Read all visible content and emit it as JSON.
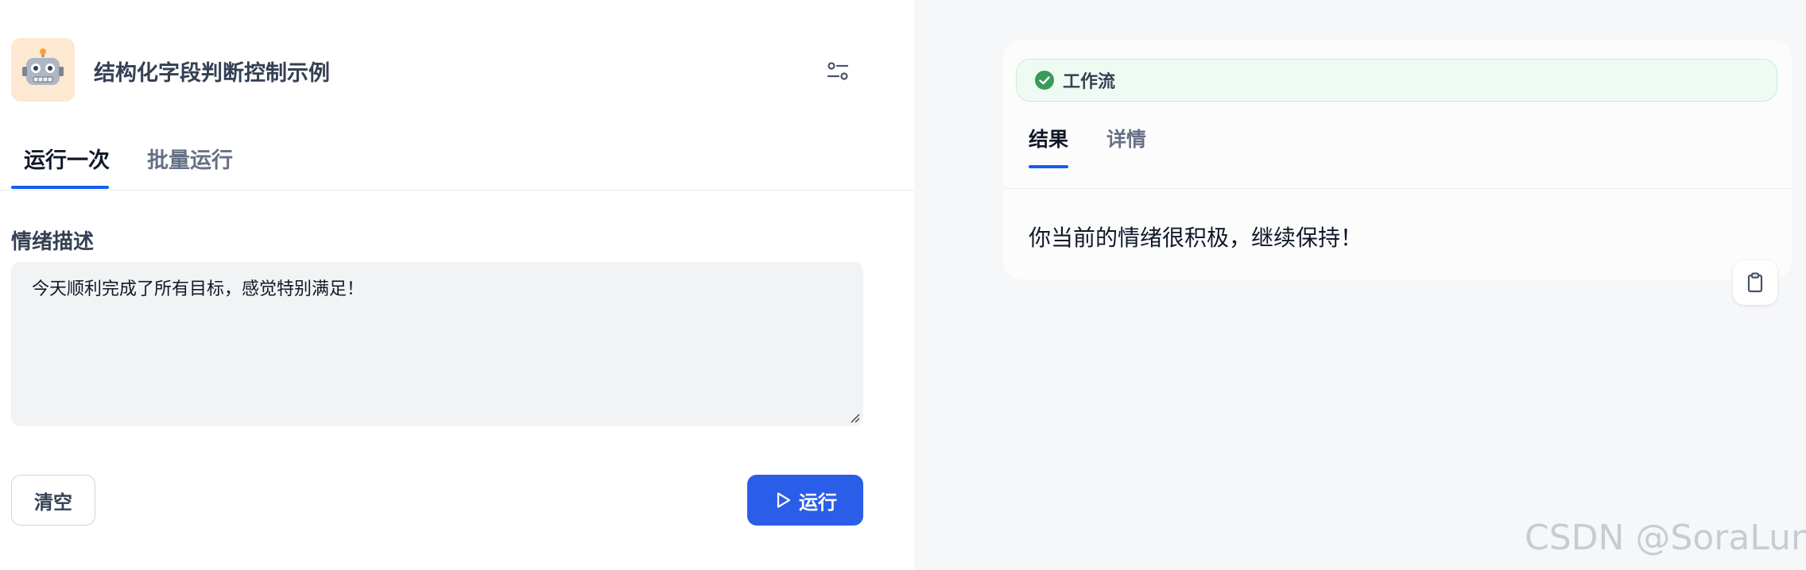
{
  "app": {
    "title": "结构化字段判断控制示例",
    "icon": "robot-icon",
    "settings_icon": "settings-sliders-icon"
  },
  "tabs": {
    "run_once": "运行一次",
    "batch_run": "批量运行"
  },
  "form": {
    "field_label": "情绪描述",
    "field_value": "今天顺利完成了所有目标，感觉特别满足！"
  },
  "actions": {
    "clear_label": "清空",
    "run_label": "运行",
    "run_icon": "play-icon"
  },
  "result": {
    "status_label": "工作流",
    "status_icon": "check-circle-icon",
    "status_color": "#3a9a5b",
    "tabs": {
      "result": "结果",
      "detail": "详情"
    },
    "output_text": "你当前的情绪很积极，继续保持！",
    "copy_icon": "clipboard-icon"
  },
  "watermark": "CSDN @SoraLuna",
  "colors": {
    "accent": "#155eef",
    "run_button": "#2a5de8",
    "app_icon_bg": "#fde8d2"
  }
}
